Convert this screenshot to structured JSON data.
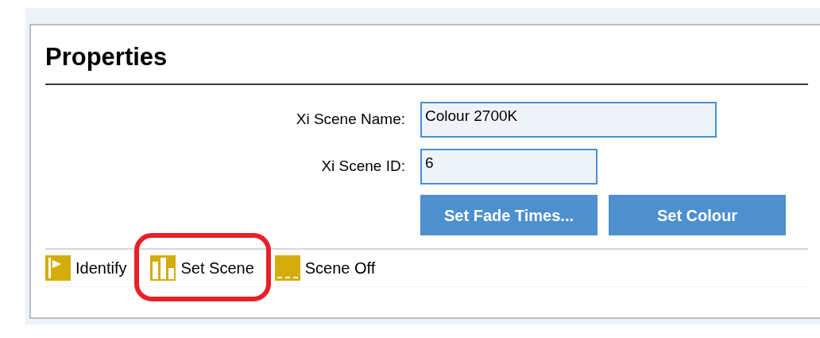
{
  "panel": {
    "title": "Properties"
  },
  "fields": [
    {
      "label": "Xi Scene Name:",
      "value": "Colour 2700K"
    },
    {
      "label": "Xi Scene ID:",
      "value": "6"
    }
  ],
  "buttons": [
    "Set Fade Times...",
    "Set Colour"
  ],
  "toolbar": [
    {
      "kind": "flag",
      "label": "Identify",
      "highlighted": false
    },
    {
      "kind": "bars",
      "label": "Set Scene",
      "highlighted": true
    },
    {
      "kind": "dashes",
      "label": "Scene Off",
      "highlighted": false
    }
  ]
}
